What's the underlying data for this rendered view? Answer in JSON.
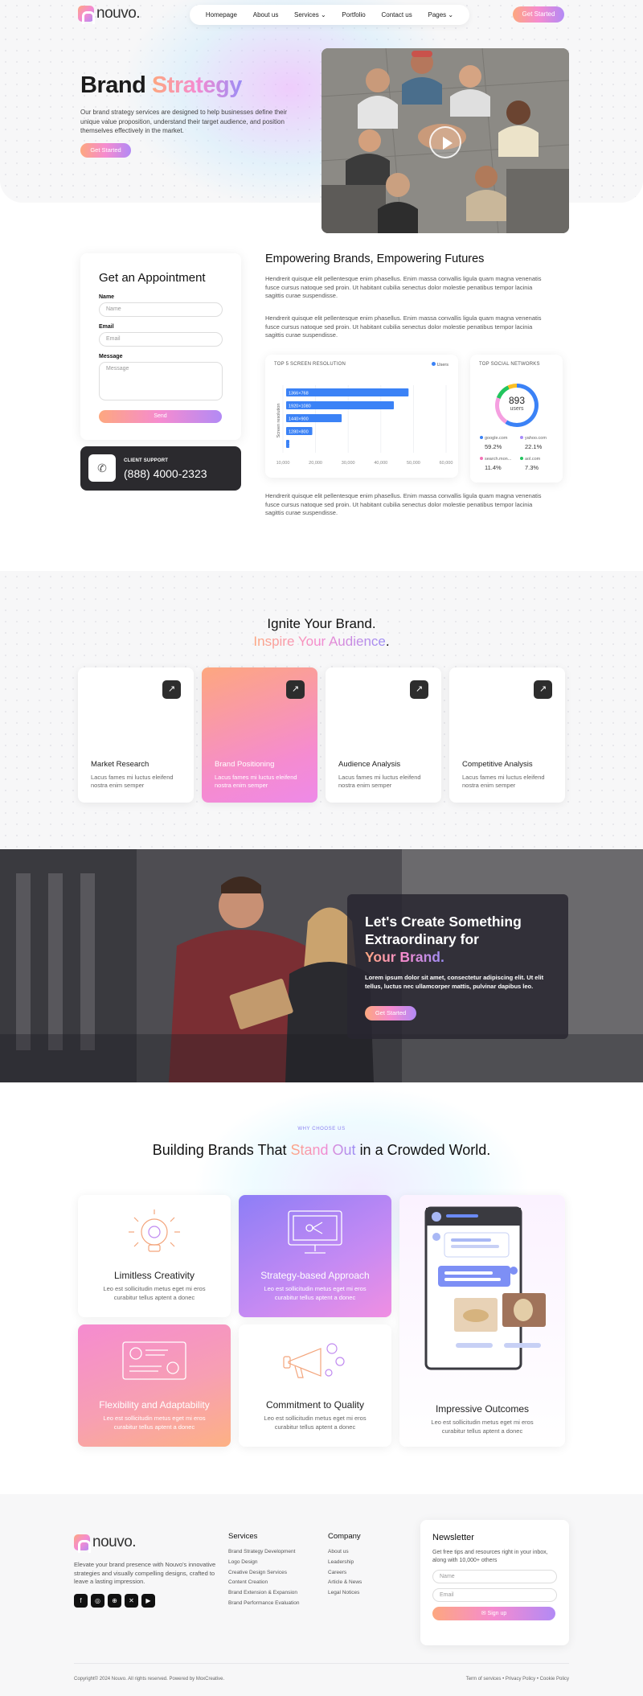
{
  "header": {
    "logo_text": "nouvo.",
    "nav": [
      "Homepage",
      "About us",
      "Services",
      "Portfolio",
      "Contact us",
      "Pages"
    ],
    "cta_label": "Get Started"
  },
  "hero": {
    "title_part1": "Brand",
    "title_part2": "Strategy",
    "description": "Our brand strategy services are designed to help businesses define their unique value proposition, understand their target audience, and position themselves effectively in the market.",
    "button_label": "Get Started"
  },
  "appointment": {
    "title": "Get an Appointment",
    "name_label": "Name",
    "name_placeholder": "Name",
    "email_label": "Email",
    "email_placeholder": "Email",
    "message_label": "Message",
    "message_placeholder": "Message",
    "send_label": "Send"
  },
  "support": {
    "label": "CLIENT SUPPORT",
    "phone": "(888) 4000-2323"
  },
  "empowering": {
    "title": "Empowering Brands, Empowering Futures",
    "paragraphs": [
      "Hendrerit quisque elit pellentesque enim phasellus. Enim massa convallis ligula quam magna venenatis fusce cursus natoque sed proin. Ut habitant cubilia senectus dolor molestie penatibus tempor lacinia sagittis curae suspendisse.",
      "Hendrerit quisque elit pellentesque enim phasellus. Enim massa convallis ligula quam magna venenatis fusce cursus natoque sed proin. Ut habitant cubilia senectus dolor molestie penatibus tempor lacinia sagittis curae suspendisse.",
      "Hendrerit quisque elit pellentesque enim phasellus. Enim massa convallis ligula quam magna venenatis fusce cursus natoque sed proin. Ut habitant cubilia senectus dolor molestie penatibus tempor lacinia sagittis curae suspendisse."
    ]
  },
  "chart_data": [
    {
      "type": "bar",
      "orientation": "horizontal",
      "title": "TOP 5 SCREEN RESOLUTION",
      "ylabel": "Screen resolution",
      "categories": [
        "1366×768",
        "1920×1080",
        "1440×900",
        "1280×800",
        "1600×900"
      ],
      "series": [
        {
          "name": "Users",
          "values": [
            48500,
            44000,
            28000,
            19000,
            8000
          ]
        }
      ],
      "xlim": [
        10000,
        60000
      ],
      "x_ticks": [
        "10,000",
        "20,000",
        "30,000",
        "40,000",
        "50,000",
        "60,000"
      ],
      "grid": true,
      "legend": "top-right",
      "color": "#3b82f6"
    },
    {
      "type": "pie",
      "title": "TOP SOCIAL NETWORKS",
      "center_value": "893",
      "center_label": "users",
      "slices": [
        {
          "label": "google.com",
          "value": "59.2%",
          "color": "#3b82f6"
        },
        {
          "label": "yahoo.com",
          "value": "22.1%",
          "color": "#a78bfa"
        },
        {
          "label": "search.mon...",
          "value": "11.4%",
          "color": "#f472b6"
        },
        {
          "label": "aol.com",
          "value": "7.3%",
          "color": "#22c55e"
        }
      ]
    }
  ],
  "ignite": {
    "title_line1": "Ignite Your Brand.",
    "title_line2": "Inspire Your Audience",
    "title_dot": ".",
    "cards": [
      {
        "title": "Market Research",
        "desc": "Lacus fames mi luctus eleifend nostra enim semper"
      },
      {
        "title": "Brand Positioning",
        "desc": "Lacus fames mi luctus eleifend nostra enim semper"
      },
      {
        "title": "Audience Analysis",
        "desc": "Lacus fames mi luctus eleifend nostra enim semper"
      },
      {
        "title": "Competitive Analysis",
        "desc": "Lacus fames mi luctus eleifend nostra enim semper"
      }
    ]
  },
  "cta": {
    "title_line1": "Let's Create Something Extraordinary for",
    "title_highlight": "Your Brand.",
    "description": "Lorem ipsum dolor sit amet, consectetur adipiscing elit. Ut elit tellus, luctus nec ullamcorper mattis, pulvinar dapibus leo.",
    "button_label": "Get Started"
  },
  "why": {
    "kicker": "WHY CHOOSE US",
    "title_part1": "Building Brands That",
    "title_highlight": "Stand Out",
    "title_part2": "in a Crowded World.",
    "cards": [
      {
        "title": "Limitless Creativity",
        "desc": "Leo est sollicitudin metus eget mi eros curabitur tellus aptent a donec"
      },
      {
        "title": "Strategy-based Approach",
        "desc": "Leo est sollicitudin metus eget mi eros curabitur tellus aptent a donec"
      },
      {
        "title": "Flexibility and Adaptability",
        "desc": "Leo est sollicitudin metus eget mi eros curabitur tellus aptent a donec"
      },
      {
        "title": "Commitment to Quality",
        "desc": "Leo est sollicitudin metus eget mi eros curabitur tellus aptent a donec"
      },
      {
        "title": "Impressive Outcomes",
        "desc": "Leo est sollicitudin metus eget mi eros curabitur tellus aptent a donec"
      }
    ]
  },
  "footer": {
    "logo_text": "nouvo.",
    "description": "Elevate your brand presence with Nouvo's innovative strategies and visually compelling designs, crafted to leave a lasting impression.",
    "social_icons": [
      "facebook-icon",
      "instagram-icon",
      "dribbble-icon",
      "x-icon",
      "youtube-icon"
    ],
    "services_title": "Services",
    "services": [
      "Brand Strategy Development",
      "Logo Design",
      "Creative Design Services",
      "Content Creation",
      "Brand Extension & Expansion",
      "Brand Performance Evaluation"
    ],
    "company_title": "Company",
    "company": [
      "About us",
      "Leadership",
      "Careers",
      "Article & News",
      "Legal Notices"
    ],
    "newsletter_title": "Newsletter",
    "newsletter_desc": "Get free tips and resources right in your inbox, along with 10,000+ others",
    "newsletter_name_placeholder": "Name",
    "newsletter_email_placeholder": "Email",
    "newsletter_button": "Sign up",
    "copyright": "Copyright© 2024 Nouvo. All rights reserved. Powered by MoxCreative.",
    "legal_links": [
      "Term of services",
      "Privacy Policy",
      "Cookie Policy"
    ],
    "separator": "•"
  },
  "colors": {
    "accent_orange": "#fda77f",
    "accent_pink": "#f58bd0",
    "accent_purple": "#9b8cf5",
    "dark": "#2b2a2e"
  }
}
